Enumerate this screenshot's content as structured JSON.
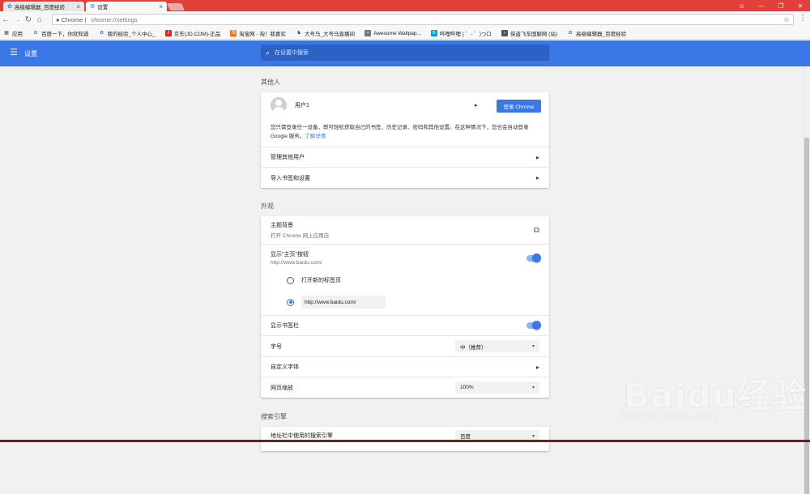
{
  "tabs": [
    {
      "title": "高级编辑器_百度经验",
      "close": "×"
    },
    {
      "title": "设置",
      "close": "×"
    }
  ],
  "window_controls": {
    "account": "☺",
    "minimize": "—",
    "restore": "❐",
    "close": "✕"
  },
  "omnibox": {
    "back": "←",
    "forward": "→",
    "reload": "↻",
    "home": "⌂",
    "security_label": "Chrome",
    "url": "chrome://settings",
    "star": "☆",
    "menu": "⋮"
  },
  "bookmarks": [
    {
      "label": "应用",
      "icon": "apps-icon",
      "color": "#888888"
    },
    {
      "label": "百度一下，你就知道",
      "icon": "paw-icon",
      "color": "#3b78e7"
    },
    {
      "label": "我的经验_个人中心_",
      "icon": "paw-icon",
      "color": "#3b78e7"
    },
    {
      "label": "京东(JD.COM)-正品",
      "icon": "jd-icon",
      "color": "#e1251b"
    },
    {
      "label": "淘宝网 - 淘！我喜欢",
      "icon": "taobao-icon",
      "color": "#ff6a00"
    },
    {
      "label": "大号马_大号马直播间",
      "icon": "horse-icon",
      "color": "#444444"
    },
    {
      "label": "Awesome Wallpap...",
      "icon": "image-icon",
      "color": "#777777"
    },
    {
      "label": "哔哩哔哩 ( ゜- ゜)つロ",
      "icon": "bilibili-icon",
      "color": "#00a1d6"
    },
    {
      "label": "侠盗飞车国服网 (站)",
      "icon": "page-icon",
      "color": "#555555"
    },
    {
      "label": "高级编辑器_百度经验",
      "icon": "paw-icon",
      "color": "#3b78e7"
    }
  ],
  "toolbar": {
    "title": "设置",
    "menu_icon": "☰"
  },
  "search": {
    "placeholder": "在设置中搜索",
    "icon": "⌕"
  },
  "people": {
    "section": "其他人",
    "user_name": "用户1",
    "signin_button": "登录 Chrome",
    "description": "您只需登录任一设备，即可轻松获取自己的书签、历史记录、密码和其他设置。在这种情况下，您也会自动登录 Google 服务。",
    "learn_more": "了解详情",
    "manage_users": "管理其他用户",
    "import": "导入书签和设置"
  },
  "appearance": {
    "section": "外观",
    "themes_label": "主题背景",
    "themes_sub": "打开 Chrome 网上应用店",
    "home_button_label": "显示\"主页\"按钮",
    "home_button_sub": "http://www.baidu.com/",
    "home_button_on": true,
    "radio_new_tab": "打开新的标签页",
    "radio_custom_url": "http://www.baidu.com/",
    "bookmarks_bar_label": "显示书签栏",
    "bookmarks_bar_on": true,
    "font_size_label": "字号",
    "font_size_value": "中（推荐）",
    "custom_fonts_label": "自定义字体",
    "zoom_label": "网页缩放",
    "zoom_value": "100%"
  },
  "search_engine": {
    "section": "搜索引擎",
    "row_label": "地址栏中使用的搜索引擎",
    "row_value": "百度"
  },
  "watermark": {
    "brand": "Baidu经验",
    "url": "jingyan.baidu.com"
  }
}
